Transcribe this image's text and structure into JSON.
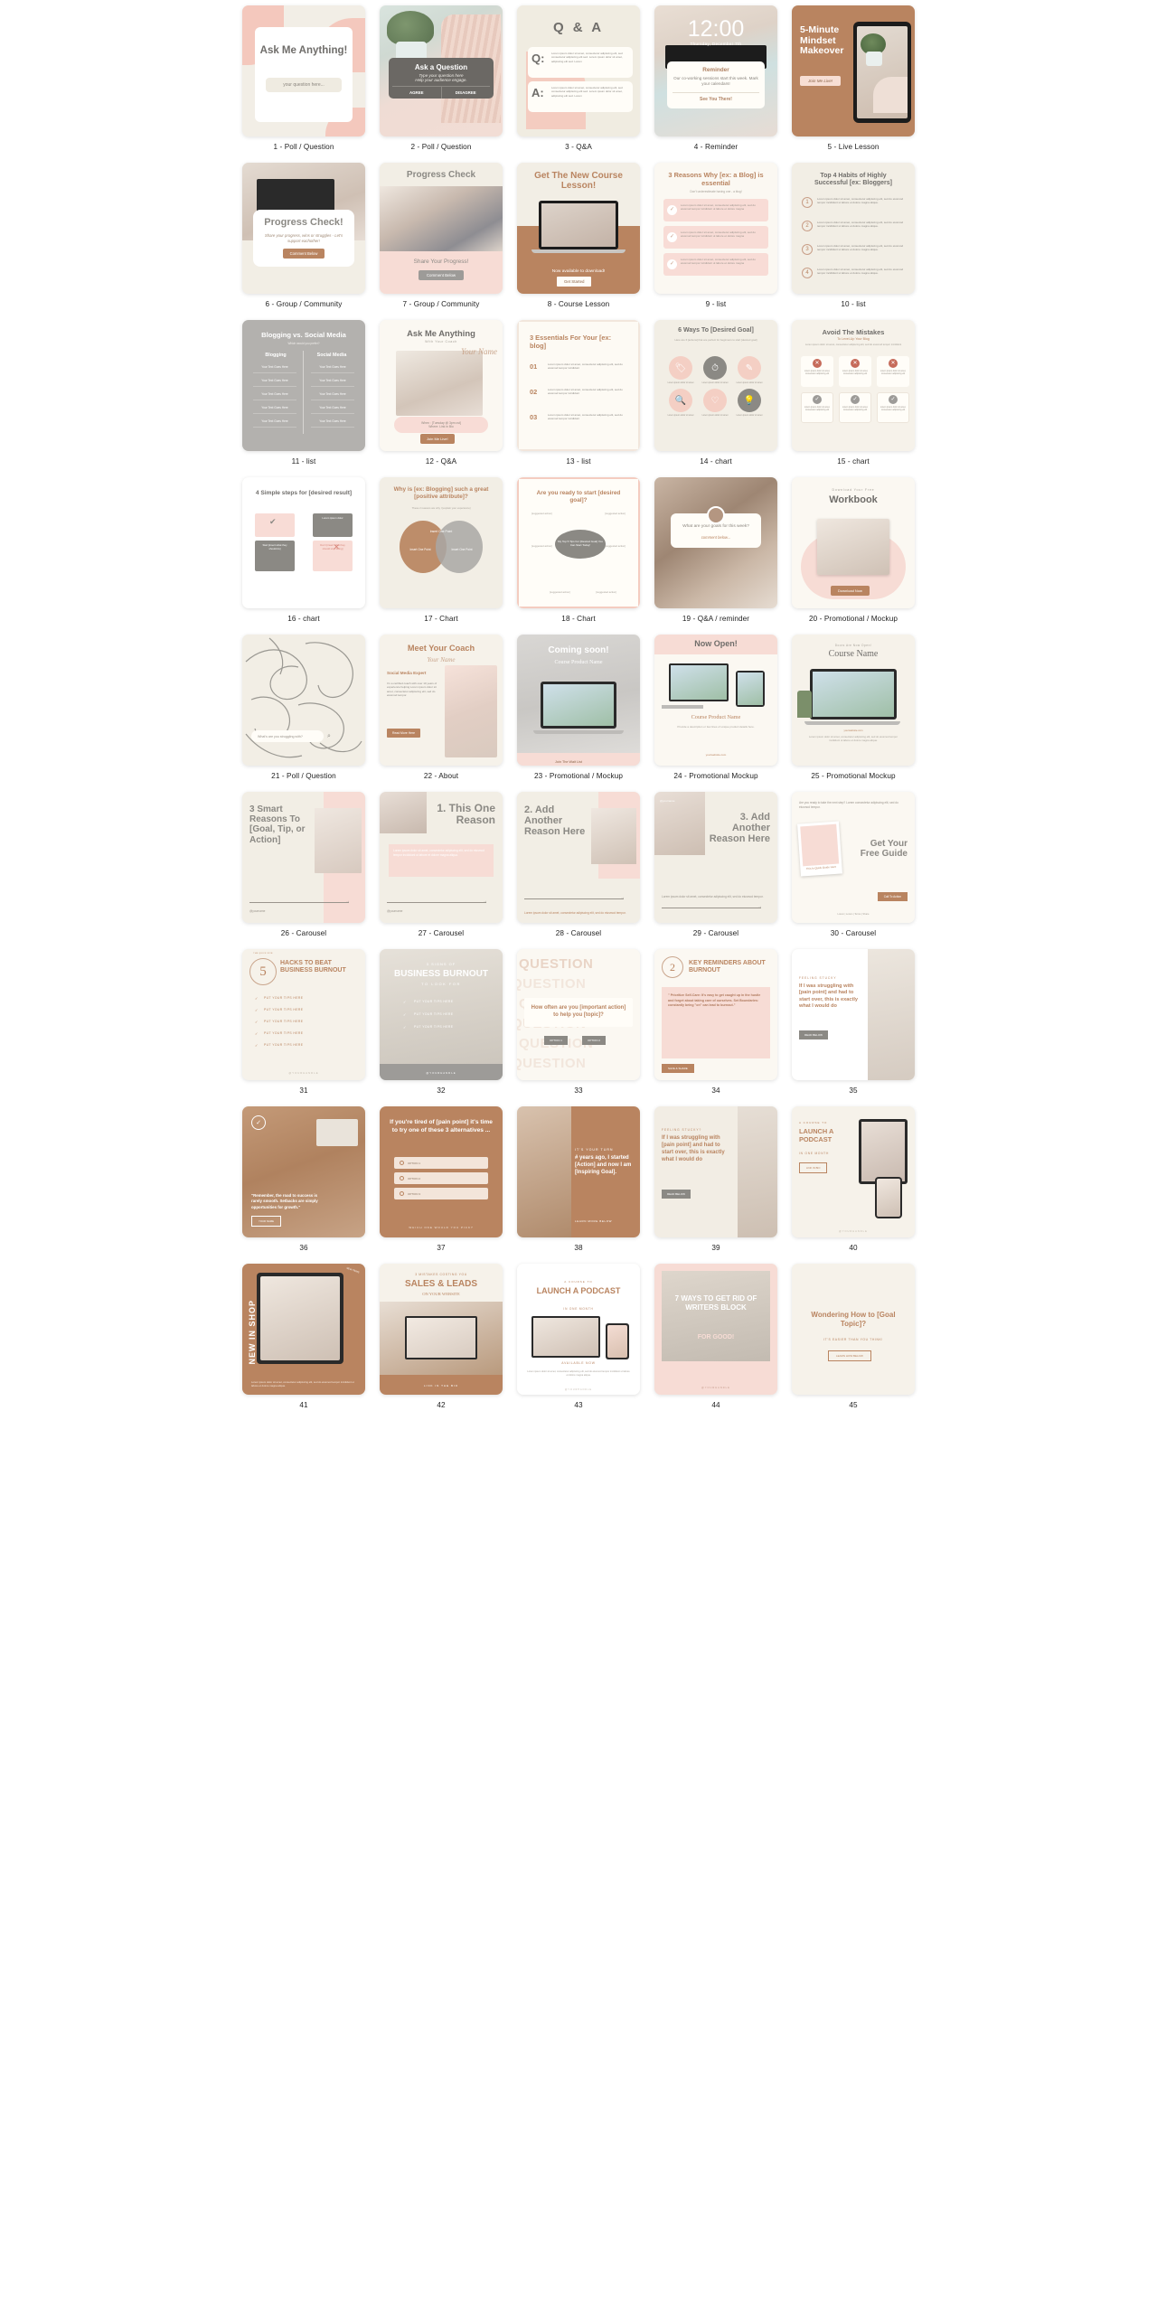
{
  "grid": {
    "columns": 5,
    "rows": 9,
    "total_items": 45
  },
  "items": [
    {
      "n": 1,
      "caption": "1 - Poll / Question",
      "title": "Ask Me Anything!",
      "input_placeholder": "your question here...",
      "kind": "poll"
    },
    {
      "n": 2,
      "caption": "2 - Poll / Question",
      "title": "Ask a Question",
      "sub1": "Type your question here",
      "sub2": "Help your audience engage.",
      "btn1": "AGREE",
      "btn2": "DISAGREE",
      "kind": "poll-photo"
    },
    {
      "n": 3,
      "caption": "3 - Q&A",
      "title": "Q & A",
      "q_label": "Q:",
      "a_label": "A:",
      "body": "Lorem ipsum dolor sit amet, consectetur adipiscing elit, sed consectetur adipiscing elit sed. Lorem ipsum dolor sit amet, adipiscing elit sed. Lorem",
      "kind": "qa"
    },
    {
      "n": 4,
      "caption": "4 - Reminder",
      "time": "12:00",
      "date": "Thursday, December 7th",
      "title": "Reminder",
      "body": "Our co-working sessions start this week. Mark your calendars!",
      "cta": "See You There!",
      "kind": "reminder"
    },
    {
      "n": 5,
      "caption": "5 - Live Lesson",
      "title": "5-Minute Mindset Makeover",
      "cta": "Join Me Live!",
      "kind": "live"
    },
    {
      "n": 6,
      "caption": "6 - Group / Community",
      "title": "Progress Check!",
      "body": "Share your progress, wins or struggles - Let's support eachother!",
      "cta": "Comment Below",
      "kind": "progress"
    },
    {
      "n": 7,
      "caption": "7 - Group / Community",
      "title": "Progress Check",
      "sub": "Share Your Progress!",
      "cta": "Comment Below",
      "kind": "progress2"
    },
    {
      "n": 8,
      "caption": "8 - Course Lesson",
      "title": "Get The New Course Lesson!",
      "sub": "Now available to download!",
      "cta": "Get Started",
      "kind": "course"
    },
    {
      "n": 9,
      "caption": "9 - list",
      "title": "3 Reasons Why [ex: a Blog] is essential",
      "subtitle": "Don't underestimate having one - a blog!",
      "rows": 3,
      "body": "Lorem ipsum dolor sit amet, consectetur adipiscing elit, sed do eiusmod tempor incididunt ut labore et dolore magna",
      "kind": "list-check"
    },
    {
      "n": 10,
      "caption": "10 - list",
      "title": "Top 4 Habits of Highly Successful [ex: Bloggers]",
      "numbers": [
        "1",
        "2",
        "3",
        "4"
      ],
      "body": "Lorem ipsum dolor sit amet, consectetur adipiscing elit, sed do eiusmod tempor incididunt ut labore et dolore magna aliqua.",
      "kind": "list-num"
    },
    {
      "n": 11,
      "caption": "11 - list",
      "title": "Blogging vs. Social Media",
      "subtitle": "Which would you prefer?",
      "col1": "Blogging",
      "col2": "Social Media",
      "cell": "Your Text Goes Here",
      "kind": "table"
    },
    {
      "n": 12,
      "caption": "12 - Q&A",
      "title": "Ask Me Anything",
      "sub": "With Your Coach",
      "script": "Your Name",
      "when": "When : [Tuesday @ 3pm cst]",
      "where": "Where: Link in Bio",
      "cta": "Join Me Live!",
      "kind": "ama"
    },
    {
      "n": 13,
      "caption": "13 - list",
      "title": "3 Essentials For Your [ex: blog]",
      "numbers": [
        "01",
        "02",
        "03"
      ],
      "body": "Lorem ipsum dolor sit amet, consectetur adipiscing elit, sed do eiusmod tempor incididunt",
      "kind": "list-03"
    },
    {
      "n": 14,
      "caption": "14 - chart",
      "title": "6 Ways To [Desired Goal]",
      "subtitle": "Here are 6 [actions] that are perfect for beginners to start [desired goal]",
      "kind": "icons6"
    },
    {
      "n": 15,
      "caption": "15 - chart",
      "title": "Avoid The Mistakes",
      "subtitle": "To Level-Up Your Blog",
      "note": "Lorem ipsum dolor sit amet, consectetur adipiscing elit, sed do eiusmod tempor incididunt",
      "body": "Lorem ipsum dolor sit amet, consectetur adipiscing elit",
      "kind": "xcheck"
    },
    {
      "n": 16,
      "caption": "16 - chart",
      "title": "4 Simple steps for [desired result]",
      "b1": "Start [insert what they should do]",
      "b2": "Don't [insert what they should stop doing]",
      "kind": "steps4"
    },
    {
      "n": 17,
      "caption": "17 - Chart",
      "title": "Why is [ex: Blogging] such a great [positive attribute]?",
      "subtitle": "These 2 reasons are why I [explain your experience]",
      "center": "Insert One Point",
      "left": "Insert One Point",
      "right": "Insert One Point",
      "kind": "venn"
    },
    {
      "n": 18,
      "caption": "18 - Chart",
      "title": "Are you ready to start [desired goal]?",
      "center": "My Top 5 Tips For [Desired Goal] You Can Start Today!",
      "node": "[suggested action]",
      "kind": "mindmap"
    },
    {
      "n": 19,
      "caption": "19 - Q&A / reminder",
      "title": "What are your goals for this week?",
      "cta": "comment below...",
      "kind": "goals"
    },
    {
      "n": 20,
      "caption": "20 - Promotional / Mockup",
      "eyebrow": "Download Your Free",
      "title": "Workbook",
      "cta": "Download Now",
      "kind": "workbook"
    },
    {
      "n": 21,
      "caption": "21 - Poll / Question",
      "placeholder": "What's are you struggling with?",
      "kind": "struggle"
    },
    {
      "n": 22,
      "caption": "22 - About",
      "title": "Meet Your Coach",
      "script": "Your Name",
      "role": "Social Media Expert",
      "body": "I'm a certified coach with over 10 years of experience helping Lorem ipsum dolor sit amet, consectetur adipiscing elit, sed do eiusmod tempor.",
      "cta": "Read More Here",
      "kind": "about"
    },
    {
      "n": 23,
      "caption": "23 - Promotional / Mockup",
      "title": "Coming soon!",
      "sub": "Course Product Name",
      "cta": "Join The Wait List",
      "kind": "coming"
    },
    {
      "n": 24,
      "caption": "24 - Promotional Mockup",
      "title": "Now Open!",
      "sub": "Course Product Name",
      "body": "Provide a description or few lines of unique product details here.",
      "link": "yourwebsite.com",
      "kind": "open"
    },
    {
      "n": 25,
      "caption": "25 - Promotional Mockup",
      "eyebrow": "Doors Are Now Open!",
      "title": "Course Name",
      "link": "yourwebsite.com",
      "body": "Lorem ipsum dolor sit amet, consectetur adipiscing elit, sed do eiusmod tempor incididunt ut labore et dolore magna aliqua.",
      "kind": "coursename"
    },
    {
      "n": 26,
      "caption": "26 - Carousel",
      "title": "3 Smart Reasons To [Goal, Tip, or Action]",
      "handle": "@yourname",
      "kind": "car1"
    },
    {
      "n": 27,
      "caption": "27 - Carousel",
      "title": "1. This One Reason",
      "body": "Lorem ipsum dolor sit amet, consectetur adipiscing elit, sed do eiusmod tempor incididunt ut labore et dolore magna aliqua.",
      "handle": "@yourname",
      "kind": "car2"
    },
    {
      "n": 28,
      "caption": "28 - Carousel",
      "title": "2. Add Another Reason Here",
      "body": "Lorem ipsum dolor sit amet, consectetur adipiscing elit, sed do eiusmod tempor.",
      "kind": "car3"
    },
    {
      "n": 29,
      "caption": "29 - Carousel",
      "handle": "@yourname",
      "title": "3. Add Another Reason Here",
      "body": "Lorem ipsum dolor sit amet, consectetur adipiscing elit, sed do eiusmod tempor.",
      "kind": "car4"
    },
    {
      "n": 30,
      "caption": "30 - Carousel",
      "body": "Are you ready to take the next step? Lorem consectetur adipiscing elit, sed do eiusmod tempor.",
      "title": "Get Your Free Guide",
      "cta": "Call To Action",
      "links": "Lorem | Lorem | Terms | Share",
      "photo_caption": "This Is Quick Guide Here",
      "kind": "car5"
    },
    {
      "n": 31,
      "caption": "31",
      "badge": "5",
      "badge_note": "THE QUICK FIVE",
      "title": "HACKS TO BEAT BUSINESS BURNOUT",
      "tip": "PUT YOUR TIPS HERE",
      "handle": "@YOURHANDLE",
      "kind": "hacks"
    },
    {
      "n": 32,
      "caption": "32",
      "eyebrow": "3 SIGNS OF",
      "title": "BUSINESS BURNOUT",
      "sub": "TO LOOK FOR",
      "tip": "PUT YOUR TIPS HERE",
      "handle": "@YOURHANDLE",
      "kind": "signs"
    },
    {
      "n": 33,
      "caption": "33",
      "ghost": "QUESTION",
      "title": "How often are you [important action] to help you [topic]?",
      "opt1": "OPTION 1",
      "opt2": "OPTION 2",
      "kind": "question"
    },
    {
      "n": 34,
      "caption": "34",
      "badge": "2",
      "title": "KEY REMINDERS ABOUT BURNOUT",
      "body": "\" Prioritize Self-Care: It's easy to get caught up in the hustle and forget about taking care of ourselves. Set Boundaries: constantly being \"on\" can lead to burnout.\"",
      "cta": "SAVE & SHARE",
      "kind": "reminders"
    },
    {
      "n": 35,
      "caption": "35",
      "eyebrow": "FEELING STUCKY",
      "title": "If I was struggling with [pain point] and had to start over, this is exactly what I would do",
      "cta": "READ BELOW",
      "kind": "stuck"
    },
    {
      "n": 36,
      "caption": "36",
      "quote": "\"Remember, the road to success is rarely smooth. Setbacks are simply opportunities for growth.\"",
      "name": "YOUR NAME",
      "kind": "quote"
    },
    {
      "n": 37,
      "caption": "37",
      "title": "If you're tired of [pain point] it's time to try one of these 3 alternatives ...",
      "options": [
        "OPTION 1",
        "OPTION 2",
        "OPTION 3"
      ],
      "footer": "WHICH ONE WOULD YOU PICK?",
      "kind": "alts"
    },
    {
      "n": 38,
      "caption": "38",
      "eyebrow": "IT'S YOUR TURN",
      "title": "# years ago, I started [Action] and now I am [Inspiring Goal].",
      "cta": "LEARN MORE BELOW",
      "kind": "turn"
    },
    {
      "n": 39,
      "caption": "39",
      "eyebrow": "FEELING STUCKY?",
      "title": "If I was struggling with [pain point] and had to start over, this is exactly what I would do",
      "cta": "READ BELOW",
      "kind": "stuck2"
    },
    {
      "n": 40,
      "caption": "40",
      "eyebrow": "A COURSE TO",
      "title": "LAUNCH A PODCAST",
      "sub": "IN ONE MONTH",
      "cta": "LINK IN BIO",
      "handle": "@YOURHANDLE",
      "kind": "podcast"
    },
    {
      "n": 41,
      "caption": "41",
      "title": "NEW IN SHOP",
      "badge": "NEW ITEMS",
      "body": "Lorem ipsum dolor sit amet, consectetur adipiscing elit, sed do eiusmod tempor incididunt ut labore et dolore magna aliqua.",
      "kind": "shop"
    },
    {
      "n": 42,
      "caption": "42",
      "eyebrow": "3 MISTAKES COSTING YOU",
      "title": "SALES & LEADS",
      "sub": "ON YOUR WEBSITE",
      "cta": "LINK IN THE BIO",
      "kind": "mistakes"
    },
    {
      "n": 43,
      "caption": "43",
      "eyebrow": "A COURSE TO",
      "title": "LAUNCH A PODCAST",
      "sub": "IN ONE MONTH",
      "avail": "AVAILABLE NOW",
      "body": "Lorem ipsum dolor sit amet, consectetur adipiscing elit, sed do eiusmod tempor incididunt ut labore et dolore magna aliqua.",
      "handle": "@YOURHANDLE",
      "kind": "podcast2"
    },
    {
      "n": 44,
      "caption": "44",
      "title": "7 WAYS TO GET RID OF WRITERS BLOCK",
      "sub": "FOR GOOD!",
      "handle": "@YOURHANDLE",
      "kind": "writers"
    },
    {
      "n": 45,
      "caption": "45",
      "title": "Wondering How to [Goal Topic]?",
      "sub": "IT'S EASIER THAN YOU THINK!",
      "cta": "LEARN HOW BELOW",
      "kind": "wonder"
    }
  ]
}
